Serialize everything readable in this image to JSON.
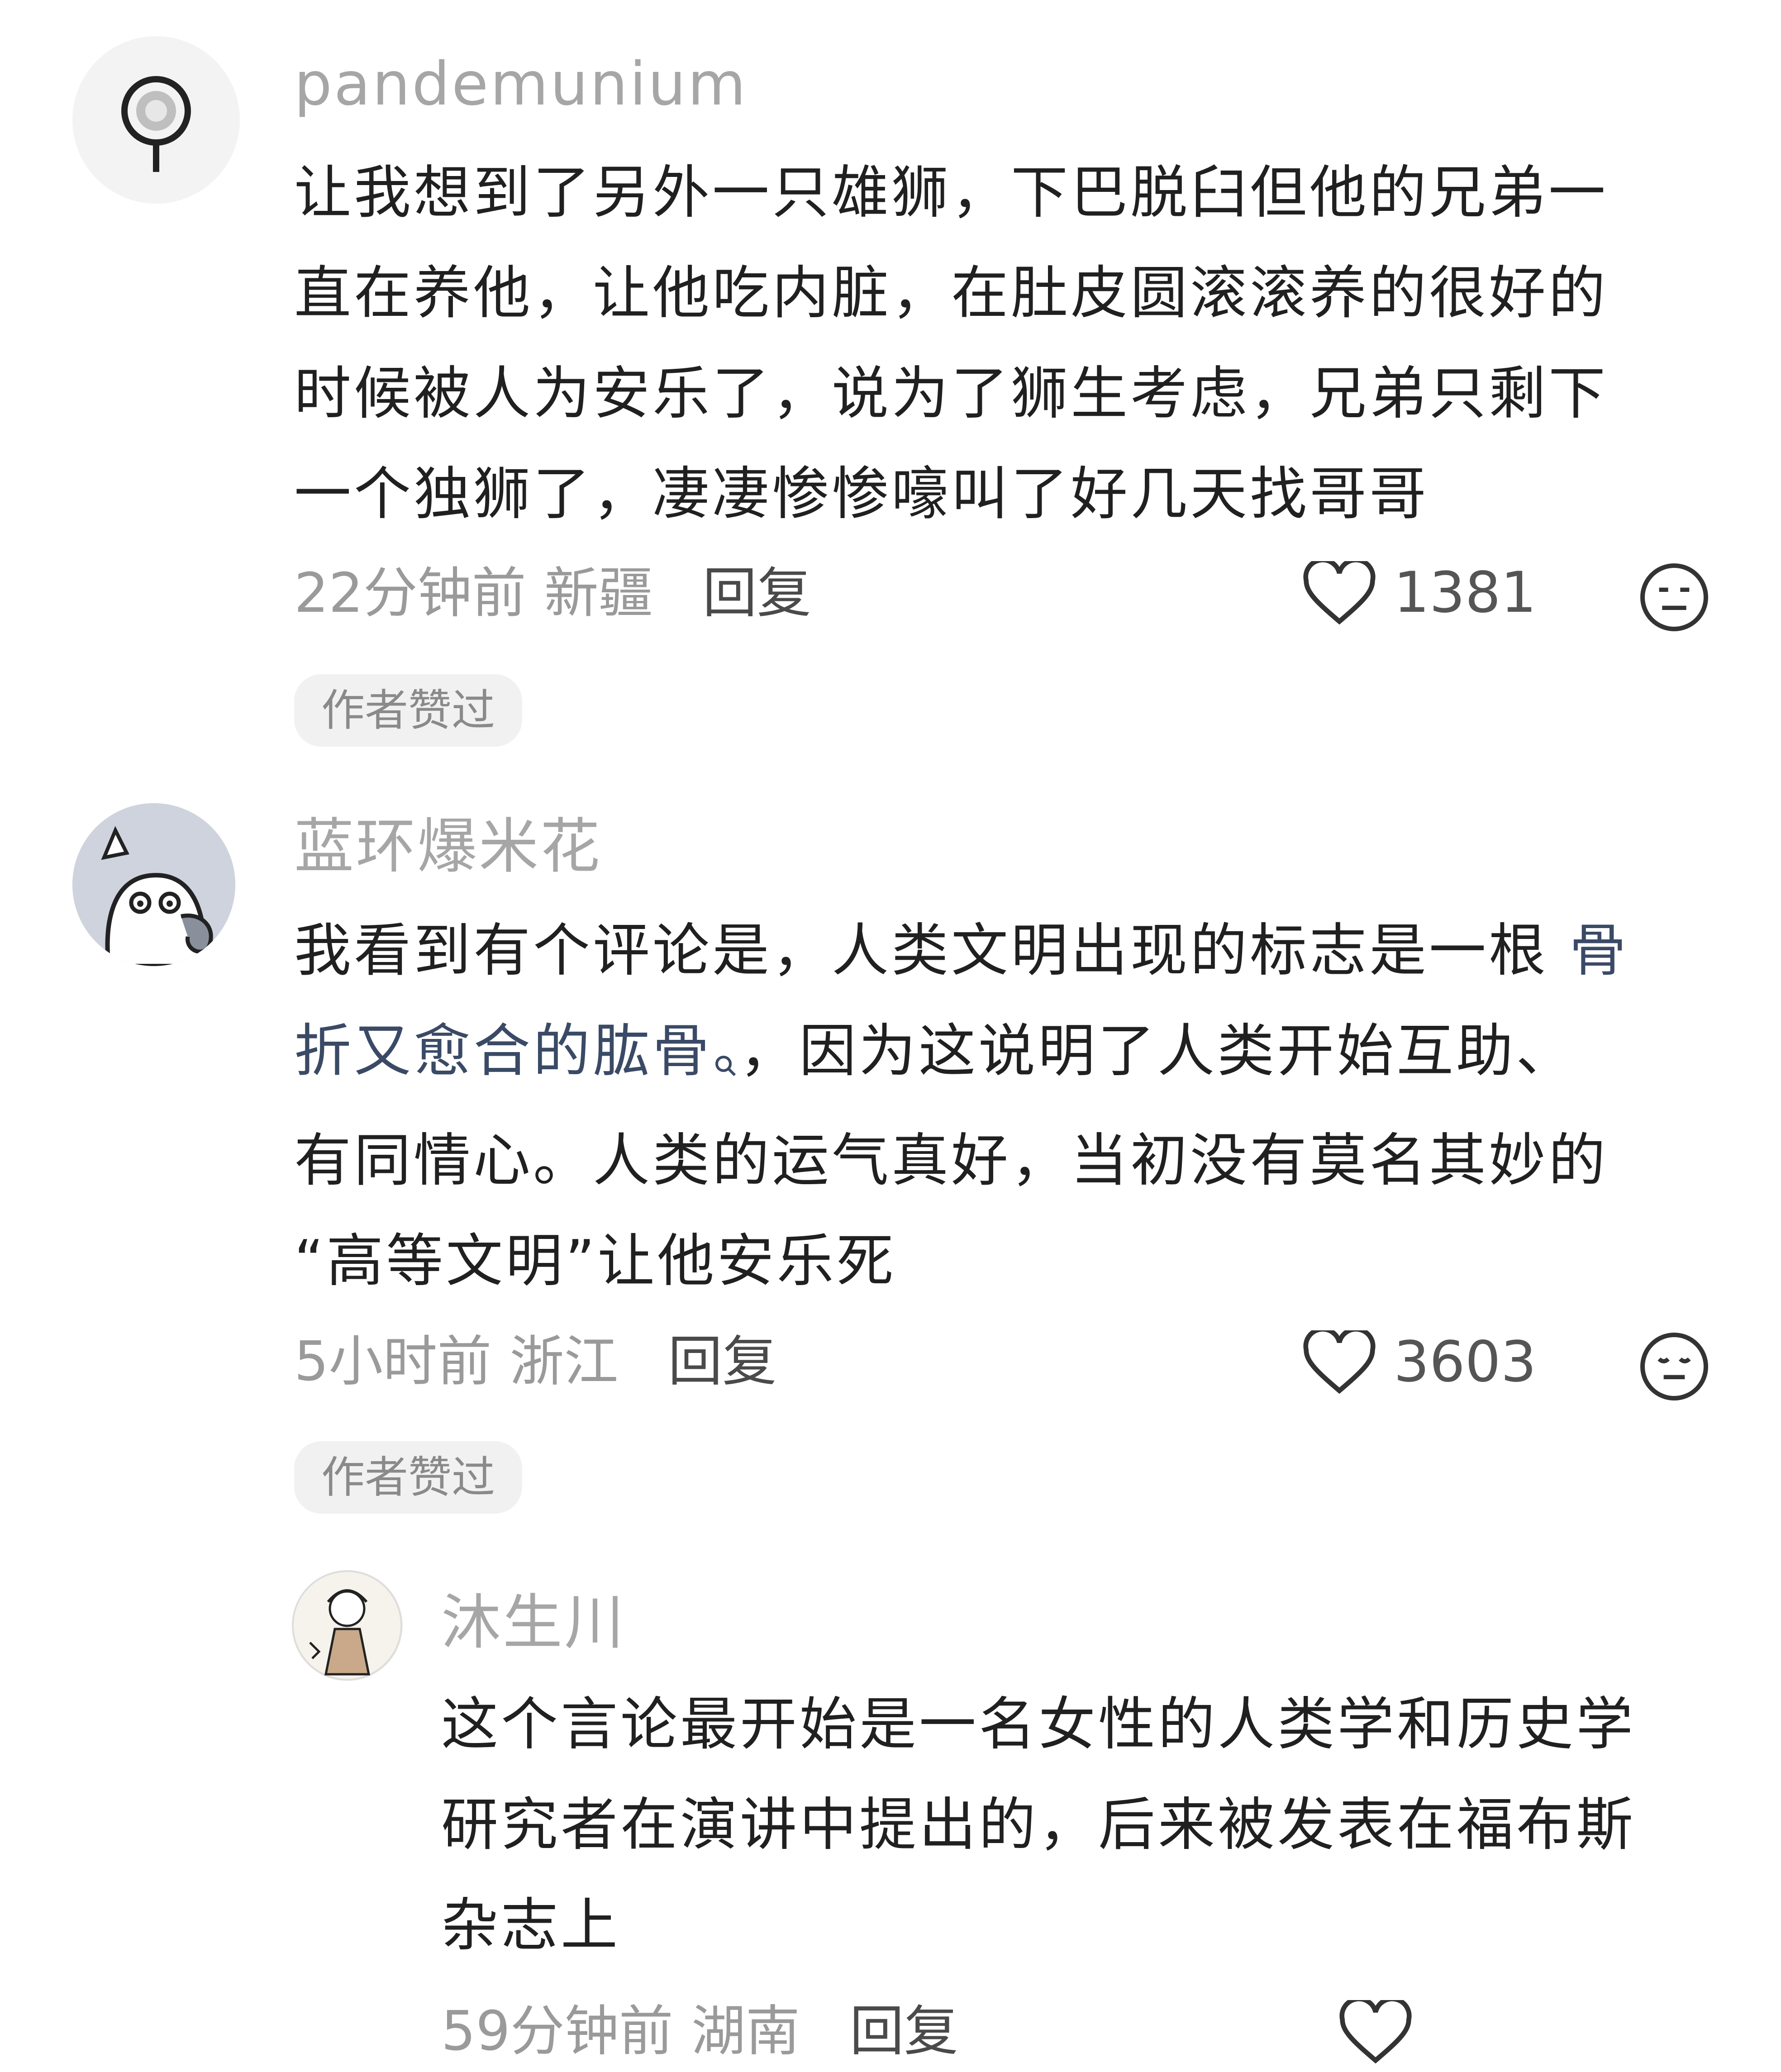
{
  "comments": [
    {
      "username": "pandemunium",
      "text_lines": [
        "让我想到了另外一只雄狮，下巴脱臼但他的兄弟一",
        "直在养他，让他吃内脏，在肚皮圆滚滚养的很好的",
        "时候被人为安乐了，说为了狮生考虑，兄弟只剩下",
        "一个独狮了，凄凄惨惨嚎叫了好几天找哥哥"
      ],
      "time": "22分钟前",
      "location": "新疆",
      "reply_label": "回复",
      "likes": "1381",
      "badge": "作者赞过"
    },
    {
      "username": "蓝环爆米花",
      "text_line1_a": "我看到有个评论是，人类文明出现的标志是一根 ",
      "text_line1_link": "骨",
      "text_line2_link": "折又愈合的肱骨",
      "text_line2_rest": "，因为这说明了人类开始互助、",
      "text_line3": "有同情心。人类的运气真好，当初没有莫名其妙的",
      "text_line4": "“高等文明”让他安乐死",
      "time": "5小时前",
      "location": "浙江",
      "reply_label": "回复",
      "likes": "3603",
      "badge": "作者赞过"
    },
    {
      "username": "沐生川",
      "text_lines": [
        "这个言论最开始是一名女性的人类学和历史学",
        "研究者在演讲中提出的，后来被发表在福布斯",
        "杂志上"
      ],
      "time": "59分钟前",
      "location": "湖南",
      "reply_label": "回复"
    }
  ],
  "icons": [
    "heart-icon",
    "meh-face-icon",
    "search-small-icon"
  ]
}
